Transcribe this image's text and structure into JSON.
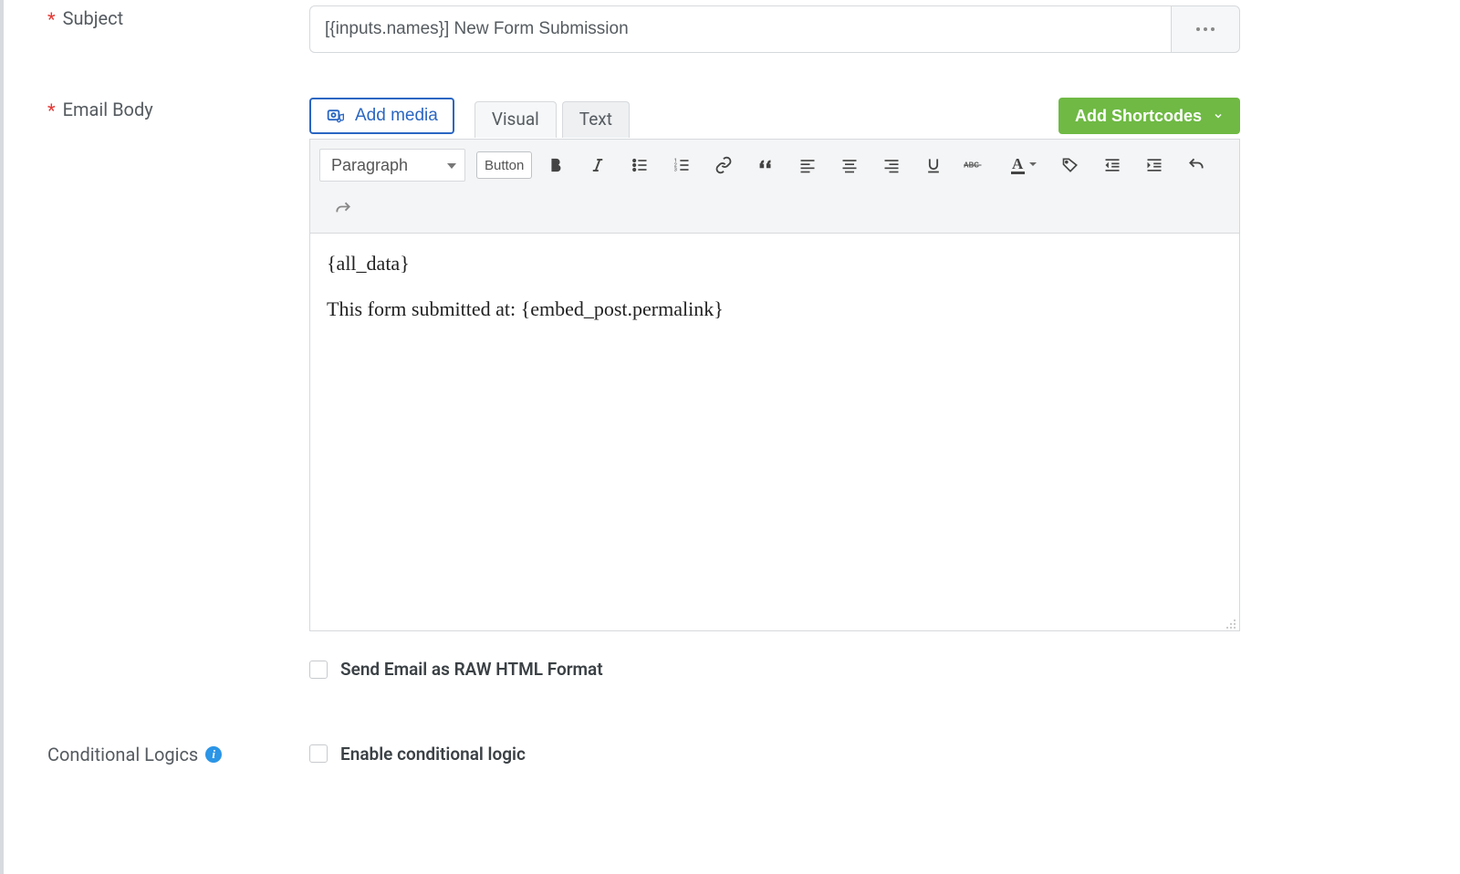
{
  "labels": {
    "subject": "Subject",
    "email_body": "Email Body",
    "conditional_logics": "Conditional Logics"
  },
  "subject": {
    "value": "[{inputs.names}] New Form Submission"
  },
  "buttons": {
    "add_media": "Add media",
    "add_shortcodes": "Add Shortcodes",
    "button": "Button"
  },
  "tabs": {
    "visual": "Visual",
    "text": "Text"
  },
  "toolbar": {
    "format_select": "Paragraph"
  },
  "editor": {
    "line1": "{all_data}",
    "line2": "This form submitted at: {embed_post.permalink}"
  },
  "checkboxes": {
    "raw_html": "Send Email as RAW HTML Format",
    "enable_conditional": "Enable conditional logic"
  }
}
